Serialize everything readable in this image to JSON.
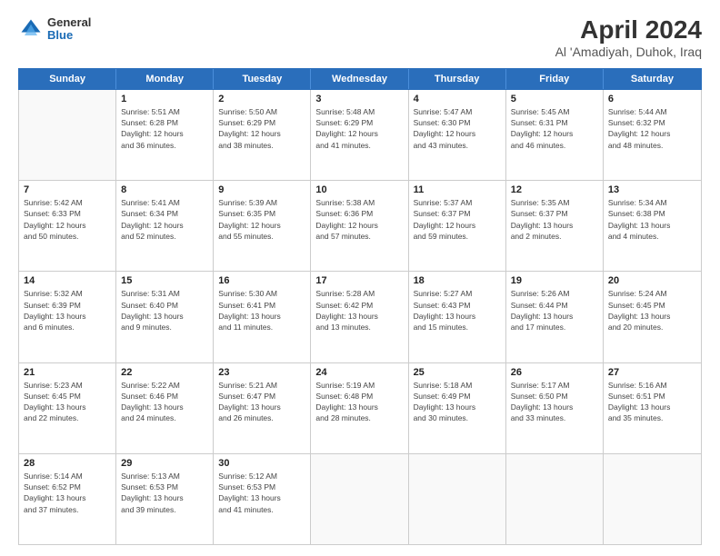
{
  "logo": {
    "general": "General",
    "blue": "Blue"
  },
  "title": "April 2024",
  "subtitle": "Al 'Amadiyah, Duhok, Iraq",
  "headers": [
    "Sunday",
    "Monday",
    "Tuesday",
    "Wednesday",
    "Thursday",
    "Friday",
    "Saturday"
  ],
  "weeks": [
    [
      {
        "day": "",
        "info": ""
      },
      {
        "day": "1",
        "info": "Sunrise: 5:51 AM\nSunset: 6:28 PM\nDaylight: 12 hours\nand 36 minutes."
      },
      {
        "day": "2",
        "info": "Sunrise: 5:50 AM\nSunset: 6:29 PM\nDaylight: 12 hours\nand 38 minutes."
      },
      {
        "day": "3",
        "info": "Sunrise: 5:48 AM\nSunset: 6:29 PM\nDaylight: 12 hours\nand 41 minutes."
      },
      {
        "day": "4",
        "info": "Sunrise: 5:47 AM\nSunset: 6:30 PM\nDaylight: 12 hours\nand 43 minutes."
      },
      {
        "day": "5",
        "info": "Sunrise: 5:45 AM\nSunset: 6:31 PM\nDaylight: 12 hours\nand 46 minutes."
      },
      {
        "day": "6",
        "info": "Sunrise: 5:44 AM\nSunset: 6:32 PM\nDaylight: 12 hours\nand 48 minutes."
      }
    ],
    [
      {
        "day": "7",
        "info": "Sunrise: 5:42 AM\nSunset: 6:33 PM\nDaylight: 12 hours\nand 50 minutes."
      },
      {
        "day": "8",
        "info": "Sunrise: 5:41 AM\nSunset: 6:34 PM\nDaylight: 12 hours\nand 52 minutes."
      },
      {
        "day": "9",
        "info": "Sunrise: 5:39 AM\nSunset: 6:35 PM\nDaylight: 12 hours\nand 55 minutes."
      },
      {
        "day": "10",
        "info": "Sunrise: 5:38 AM\nSunset: 6:36 PM\nDaylight: 12 hours\nand 57 minutes."
      },
      {
        "day": "11",
        "info": "Sunrise: 5:37 AM\nSunset: 6:37 PM\nDaylight: 12 hours\nand 59 minutes."
      },
      {
        "day": "12",
        "info": "Sunrise: 5:35 AM\nSunset: 6:37 PM\nDaylight: 13 hours\nand 2 minutes."
      },
      {
        "day": "13",
        "info": "Sunrise: 5:34 AM\nSunset: 6:38 PM\nDaylight: 13 hours\nand 4 minutes."
      }
    ],
    [
      {
        "day": "14",
        "info": "Sunrise: 5:32 AM\nSunset: 6:39 PM\nDaylight: 13 hours\nand 6 minutes."
      },
      {
        "day": "15",
        "info": "Sunrise: 5:31 AM\nSunset: 6:40 PM\nDaylight: 13 hours\nand 9 minutes."
      },
      {
        "day": "16",
        "info": "Sunrise: 5:30 AM\nSunset: 6:41 PM\nDaylight: 13 hours\nand 11 minutes."
      },
      {
        "day": "17",
        "info": "Sunrise: 5:28 AM\nSunset: 6:42 PM\nDaylight: 13 hours\nand 13 minutes."
      },
      {
        "day": "18",
        "info": "Sunrise: 5:27 AM\nSunset: 6:43 PM\nDaylight: 13 hours\nand 15 minutes."
      },
      {
        "day": "19",
        "info": "Sunrise: 5:26 AM\nSunset: 6:44 PM\nDaylight: 13 hours\nand 17 minutes."
      },
      {
        "day": "20",
        "info": "Sunrise: 5:24 AM\nSunset: 6:45 PM\nDaylight: 13 hours\nand 20 minutes."
      }
    ],
    [
      {
        "day": "21",
        "info": "Sunrise: 5:23 AM\nSunset: 6:45 PM\nDaylight: 13 hours\nand 22 minutes."
      },
      {
        "day": "22",
        "info": "Sunrise: 5:22 AM\nSunset: 6:46 PM\nDaylight: 13 hours\nand 24 minutes."
      },
      {
        "day": "23",
        "info": "Sunrise: 5:21 AM\nSunset: 6:47 PM\nDaylight: 13 hours\nand 26 minutes."
      },
      {
        "day": "24",
        "info": "Sunrise: 5:19 AM\nSunset: 6:48 PM\nDaylight: 13 hours\nand 28 minutes."
      },
      {
        "day": "25",
        "info": "Sunrise: 5:18 AM\nSunset: 6:49 PM\nDaylight: 13 hours\nand 30 minutes."
      },
      {
        "day": "26",
        "info": "Sunrise: 5:17 AM\nSunset: 6:50 PM\nDaylight: 13 hours\nand 33 minutes."
      },
      {
        "day": "27",
        "info": "Sunrise: 5:16 AM\nSunset: 6:51 PM\nDaylight: 13 hours\nand 35 minutes."
      }
    ],
    [
      {
        "day": "28",
        "info": "Sunrise: 5:14 AM\nSunset: 6:52 PM\nDaylight: 13 hours\nand 37 minutes."
      },
      {
        "day": "29",
        "info": "Sunrise: 5:13 AM\nSunset: 6:53 PM\nDaylight: 13 hours\nand 39 minutes."
      },
      {
        "day": "30",
        "info": "Sunrise: 5:12 AM\nSunset: 6:53 PM\nDaylight: 13 hours\nand 41 minutes."
      },
      {
        "day": "",
        "info": ""
      },
      {
        "day": "",
        "info": ""
      },
      {
        "day": "",
        "info": ""
      },
      {
        "day": "",
        "info": ""
      }
    ]
  ]
}
